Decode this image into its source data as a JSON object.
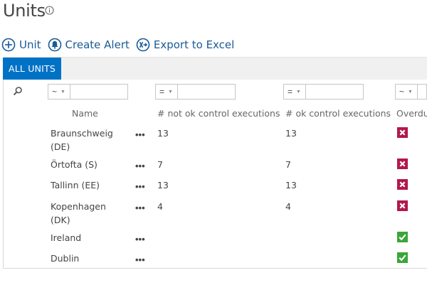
{
  "page": {
    "title": "Units"
  },
  "toolbar": {
    "unit_label": "Unit",
    "create_alert_label": "Create Alert",
    "export_label": "Export to Excel"
  },
  "tabs": [
    {
      "label": "ALL UNITS",
      "active": true
    }
  ],
  "filters": [
    {
      "operator": "~",
      "value": ""
    },
    {
      "operator": "=",
      "value": ""
    },
    {
      "operator": "=",
      "value": ""
    },
    {
      "operator": "~",
      "value": ""
    }
  ],
  "columns": {
    "name": "Name",
    "not_ok": "# not ok control executions",
    "ok": "# ok control executions",
    "overdue": "Overdue"
  },
  "rows": [
    {
      "name": "Braunschweig (DE)",
      "not_ok": "13",
      "ok": "13",
      "overdue": "no"
    },
    {
      "name": "Örtofta (S)",
      "not_ok": "7",
      "ok": "7",
      "overdue": "no"
    },
    {
      "name": "Tallinn (EE)",
      "not_ok": "13",
      "ok": "13",
      "overdue": "no"
    },
    {
      "name": "Kopenhagen (DK)",
      "not_ok": "4",
      "ok": "4",
      "overdue": "no"
    },
    {
      "name": "Ireland",
      "not_ok": "",
      "ok": "",
      "overdue": "yes"
    },
    {
      "name": "Dublin",
      "not_ok": "",
      "ok": "",
      "overdue": "yes"
    }
  ],
  "row_menu_label": "•••",
  "colors": {
    "accent": "#0072c6",
    "link": "#1a5a96",
    "status_bad": "#b3174b",
    "status_good": "#3aa63a"
  }
}
